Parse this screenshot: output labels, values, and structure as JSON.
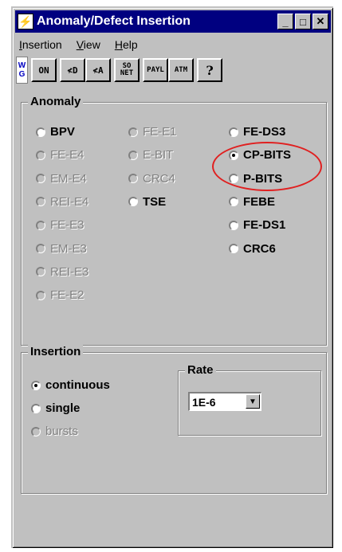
{
  "window": {
    "title": "Anomaly/Defect Insertion",
    "minimize_label": "_",
    "maximize_label": "□",
    "close_label": "✕",
    "app_icon_glyph": "⚡"
  },
  "menu": {
    "items": [
      {
        "key": "I",
        "rest": "nsertion"
      },
      {
        "key": "V",
        "rest": "iew"
      },
      {
        "key": "H",
        "rest": "elp"
      }
    ]
  },
  "toolbar": {
    "logo_text": "W\nG",
    "on": "ON",
    "d": "≮D",
    "a": "≮A",
    "sonet_top": "SO",
    "sonet_bottom": "NET",
    "payl": "PAYL",
    "atm": "ATM",
    "help": "?"
  },
  "anomaly": {
    "legend": "Anomaly",
    "col1": [
      {
        "label": "BPV",
        "enabled": true,
        "selected": false
      },
      {
        "label": "FE-E4",
        "enabled": false,
        "selected": false
      },
      {
        "label": "EM-E4",
        "enabled": false,
        "selected": false
      },
      {
        "label": "REI-E4",
        "enabled": false,
        "selected": false
      },
      {
        "label": "FE-E3",
        "enabled": false,
        "selected": false
      },
      {
        "label": "EM-E3",
        "enabled": false,
        "selected": false
      },
      {
        "label": "REI-E3",
        "enabled": false,
        "selected": false
      },
      {
        "label": "FE-E2",
        "enabled": false,
        "selected": false
      }
    ],
    "col2": [
      {
        "label": "FE-E1",
        "enabled": false,
        "selected": false
      },
      {
        "label": "E-BIT",
        "enabled": false,
        "selected": false
      },
      {
        "label": "CRC4",
        "enabled": false,
        "selected": false
      },
      {
        "label": "TSE",
        "enabled": true,
        "selected": false
      }
    ],
    "col3": [
      {
        "label": "FE-DS3",
        "enabled": true,
        "selected": false
      },
      {
        "label": "CP-BITS",
        "enabled": true,
        "selected": true
      },
      {
        "label": "P-BITS",
        "enabled": true,
        "selected": false
      },
      {
        "label": "FEBE",
        "enabled": true,
        "selected": false
      },
      {
        "label": "FE-DS1",
        "enabled": true,
        "selected": false
      },
      {
        "label": "CRC6",
        "enabled": true,
        "selected": false
      }
    ]
  },
  "insertion": {
    "legend": "Insertion",
    "options": [
      {
        "label": "continuous",
        "enabled": true,
        "selected": true
      },
      {
        "label": "single",
        "enabled": true,
        "selected": false
      },
      {
        "label": "bursts",
        "enabled": false,
        "selected": false
      }
    ],
    "rate": {
      "legend": "Rate",
      "value": "1E-6",
      "arrow": "▼"
    }
  },
  "colors": {
    "titlebar": "#000080",
    "highlight": "#e02020"
  }
}
